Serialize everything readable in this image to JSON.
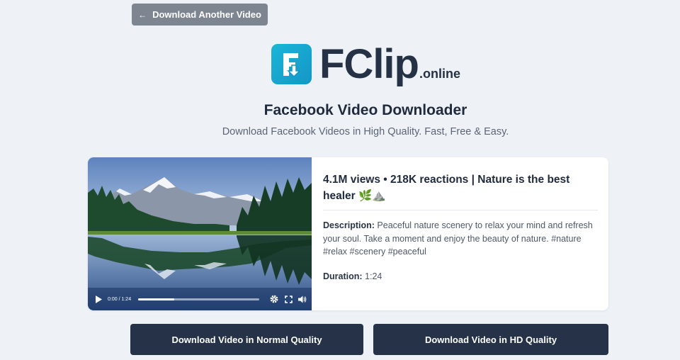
{
  "back_button": {
    "label": "Download Another Video",
    "icon": "arrow-left-icon"
  },
  "brand": {
    "name": "FClip",
    "tld": ".online",
    "logo_icon": "download-arrow-icon",
    "accent": "#1ba7d1"
  },
  "header": {
    "title": "Facebook Video Downloader",
    "subtitle": "Download Facebook Videos in High Quality. Fast, Free & Easy."
  },
  "video": {
    "title": "4.1M views • 218K reactions | Nature is the best healer 🌿⛰️",
    "description_label": "Description:",
    "description": "Peaceful nature scenery to relax your mind and refresh your soul. Take a moment and enjoy the beauty of nature. #nature #relax #scenery #peaceful",
    "duration_label": "Duration:",
    "duration": "1:24",
    "player": {
      "time": "0:00 / 1:24",
      "buffered_fraction": 0.3
    }
  },
  "downloads": {
    "normal_label": "Download Video in Normal Quality",
    "hd_label": "Download Video in HD Quality"
  },
  "colors": {
    "page_bg": "#eef1f6",
    "button_dark": "#253248",
    "back_button": "#7d8590"
  }
}
